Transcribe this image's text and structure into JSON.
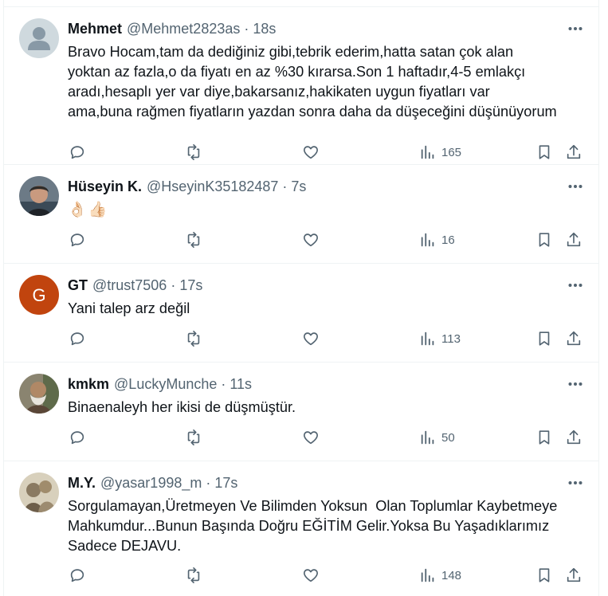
{
  "tweets": [
    {
      "name": "Mehmet",
      "handle": "@Mehmet2823as",
      "time": "18s",
      "text": "Bravo Hocam,tam da dediğiniz gibi,tebrik ederim,hatta satan çok alan\nyoktan az fazla,o da fiyatı en az %30 kırarsa.Son 1 haftadır,4-5 emlakçı\naradı,hesaplı yer var diye,bakarsanız,hakikaten uygun fiyatları var\nama,buna rağmen fiyatların yazdan sonra daha da düşeceğini düşünüyorum",
      "views": "165",
      "avatar": "default-avatar-icon"
    },
    {
      "name": "Hüseyin K.",
      "handle": "@HseyinK35182487",
      "time": "7s",
      "text": "👌🏻👍🏻",
      "views": "16",
      "avatar": "photo-avatar"
    },
    {
      "name": "GT",
      "handle": "@trust7506",
      "time": "17s",
      "text": "Yani talep arz değil",
      "views": "113",
      "avatar": "letter-avatar",
      "avatar_letter": "G",
      "avatar_color": "#c1440e"
    },
    {
      "name": "kmkm",
      "handle": "@LuckyMunche",
      "time": "11s",
      "text": "Binaenaleyh her ikisi de düşmüştür.",
      "views": "50",
      "avatar": "photo-avatar"
    },
    {
      "name": "M.Y.",
      "handle": "@yasar1998_m",
      "time": "17s",
      "text": "Sorgulamayan,Üretmeyen Ve Bilimden Yoksun  Olan Toplumlar Kaybetmeye\nMahkumdur...Bunun Başında Doğru EĞİTİM Gelir.Yoksa Bu Yaşadıklarımız\nSadece DEJAVU.",
      "views": "148",
      "avatar": "photo-avatar"
    }
  ],
  "separator": "·",
  "colors": {
    "text": "#0f1419",
    "secondary": "#536471",
    "border": "#eff3f4"
  }
}
